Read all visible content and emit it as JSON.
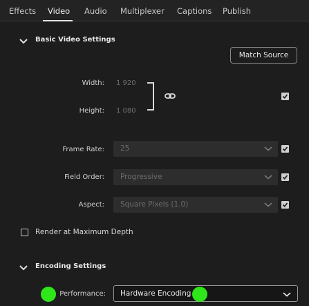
{
  "tabs": [
    "Effects",
    "Video",
    "Audio",
    "Multiplexer",
    "Captions",
    "Publish"
  ],
  "basic_section": {
    "title": "Basic Video Settings",
    "match_source_label": "Match Source"
  },
  "dimensions": {
    "width_label": "Width:",
    "width_value": "1 920",
    "height_label": "Height:",
    "height_value": "1 080"
  },
  "frame_rate": {
    "label": "Frame Rate:",
    "value": "25"
  },
  "field_order": {
    "label": "Field Order:",
    "value": "Progressive"
  },
  "aspect": {
    "label": "Aspect:",
    "value": "Square Pixels (1.0)"
  },
  "render_max_depth": {
    "label": "Render at Maximum Depth"
  },
  "encoding_section": {
    "title": "Encoding Settings"
  },
  "performance": {
    "label": "Performance:",
    "value": "Hardware Encoding"
  },
  "icons": {
    "chevron": "chevron-down-icon",
    "link": "link-icon",
    "check": "checkmark-icon"
  },
  "colors": {
    "marker": "#2ee61a",
    "background": "#1d1d1d"
  }
}
